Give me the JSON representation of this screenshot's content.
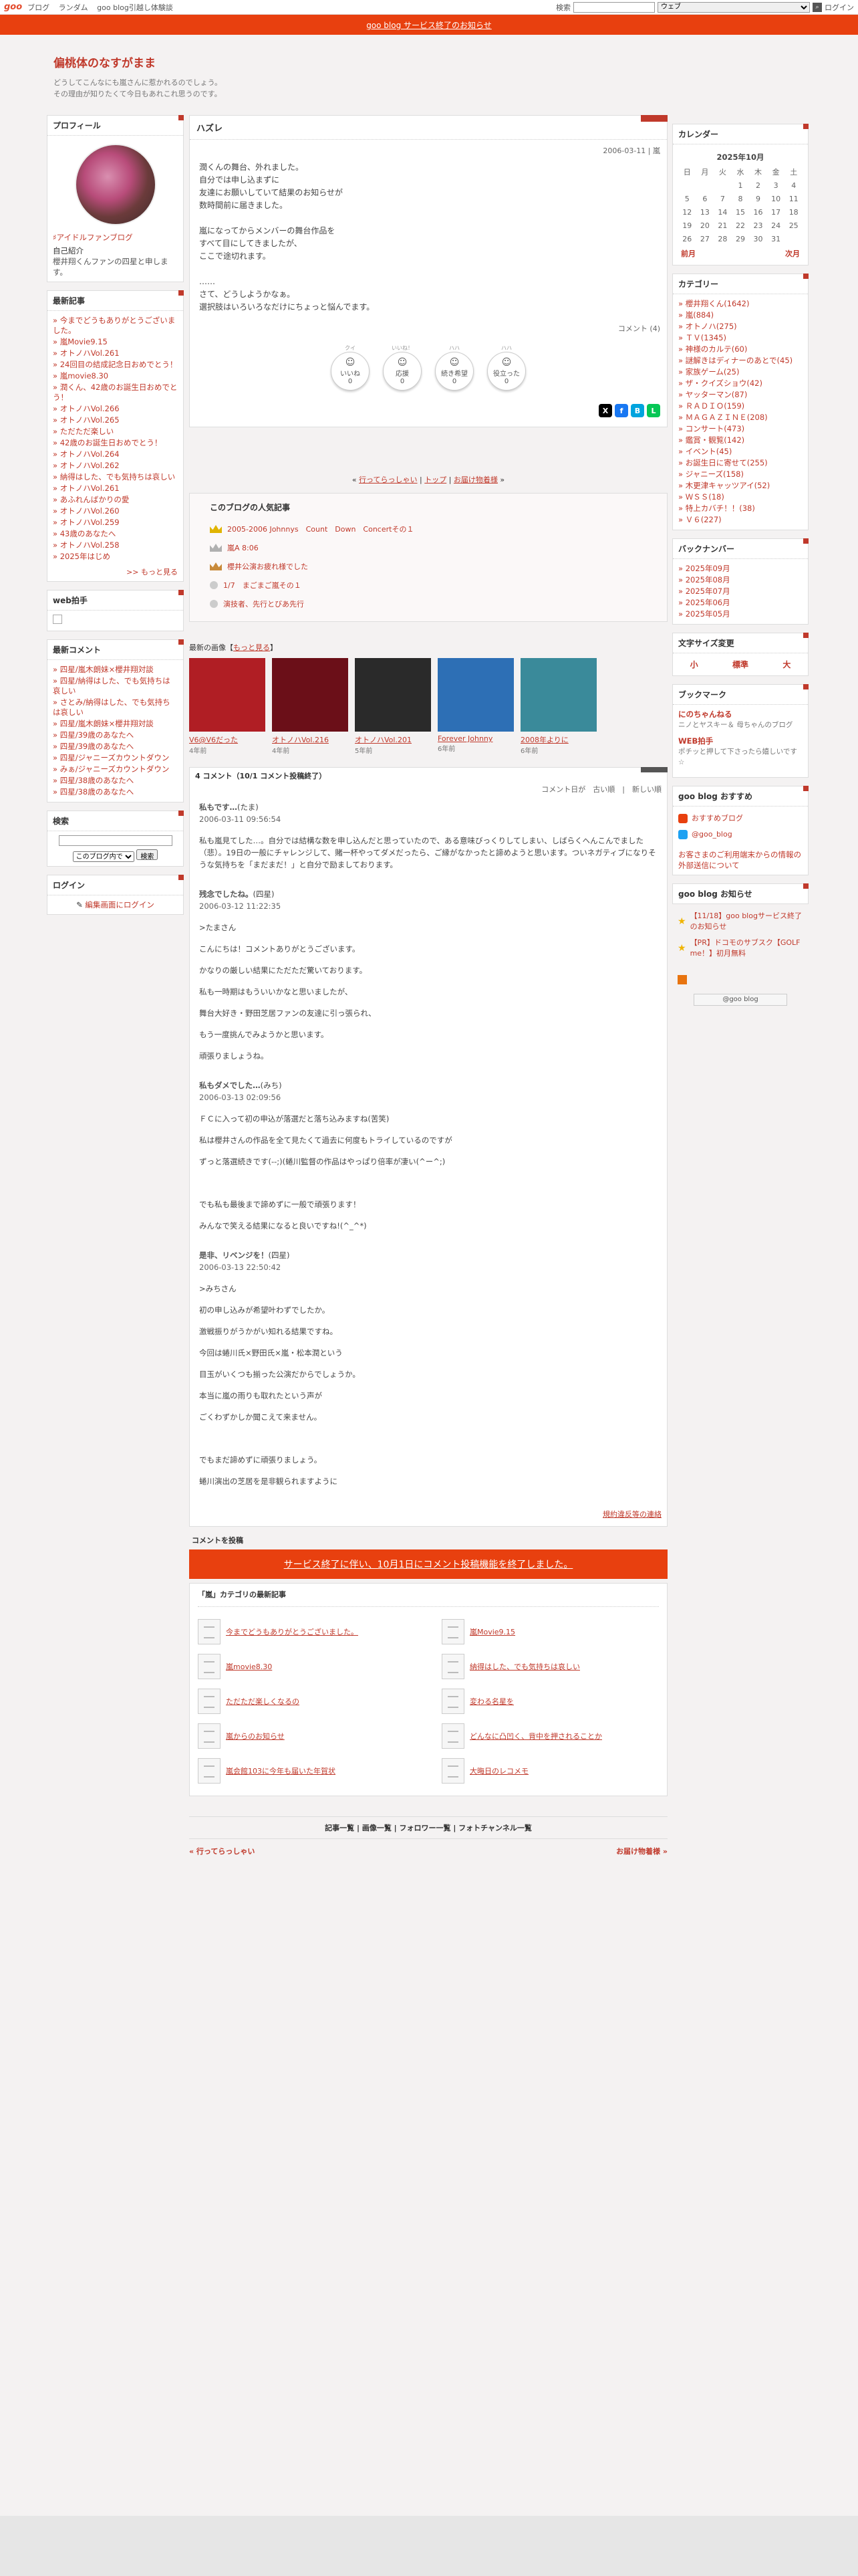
{
  "topbar": {
    "logo": "goo",
    "nav": [
      "ブログ",
      "ランダム",
      "goo blog引越し体験談"
    ],
    "search_label": "検索",
    "search_select": "ウェブ",
    "login": "ログイン"
  },
  "notice": "goo blog サービス終了のお知らせ",
  "header": {
    "title": "偏桃体のなすがまま",
    "desc1": "どうしてこんなにも嵐さんに惹かれるのでしょう。",
    "desc2": "その理由が知りたくて今日もあれこれ思うのです。"
  },
  "left": {
    "profile": {
      "heading": "プロフィール",
      "fan": "♯アイドルファンブログ",
      "intro_label": "自己紹介",
      "intro": "櫻井翔くんファンの四星と申します。"
    },
    "recent": {
      "heading": "最新記事",
      "items": [
        "今までどうもありがとうございました。",
        "嵐Movie9.15",
        "オトノハVol.261",
        "24回目の結成記念日おめでとう！",
        "嵐movie8.30",
        "潤くん、42歳のお誕生日おめでとう！",
        "オトノハVol.266",
        "オトノハVol.265",
        "ただただ楽しい",
        "42歳のお誕生日おめでとう！",
        "オトノハVol.264",
        "オトノハVol.262",
        "納得はした、でも気持ちは哀しい",
        "オトノハVol.261",
        "あふれんばかりの愛",
        "オトノハVol.260",
        "オトノハVol.259",
        "43歳のあなたへ",
        "オトノハVol.258",
        "2025年はじめ"
      ],
      "more": ">> もっと見る"
    },
    "webclap": {
      "heading": "web拍手"
    },
    "comments": {
      "heading": "最新コメント",
      "items": [
        "四星/嵐木朗妹×櫻井翔対談",
        "四星/納得はした、でも気持ちは哀しい",
        "さとみ/納得はした、でも気持ちは哀しい",
        "四星/嵐木朗妹×櫻井翔対談",
        "四星/39歳のあなたへ",
        "四星/39歳のあなたへ",
        "四星/ジャニーズカウントダウン",
        "みぁ/ジャニーズカウントダウン",
        "四星/38歳のあなたへ",
        "四星/38歳のあなたへ"
      ]
    },
    "search": {
      "heading": "検索",
      "select": "このブログ内で",
      "button": "検索"
    },
    "login": {
      "heading": "ログイン",
      "link": "編集画面にログイン"
    }
  },
  "article": {
    "title": "ハズレ",
    "date": "2006-03-11 | 嵐",
    "lines": [
      "潤くんの舞台、外れました。",
      "自分では申し込まずに",
      "友達にお願いしていて結果のお知らせが",
      "数時間前に届きました。",
      "",
      "嵐になってからメンバーの舞台作品を",
      "すべて目にしてきましたが、",
      "ここで途切れます。",
      "",
      "……",
      "さて、どうしようかなぁ。",
      "選択肢はいろいろなだけにちょっと悩んでます。"
    ],
    "comment_link": "コメント (4)",
    "reactions": [
      {
        "top": "クイ",
        "label": "いいね",
        "count": "0"
      },
      {
        "top": "いいね！",
        "label": "応援",
        "count": "0"
      },
      {
        "top": "ハハ",
        "label": "続き希望",
        "count": "0"
      },
      {
        "top": "ハハ",
        "label": "役立った",
        "count": "0"
      }
    ]
  },
  "pagenav": {
    "prev": "行ってらっしゃい",
    "top": "トップ",
    "next": "お届け物着様"
  },
  "popular": {
    "heading": "このブログの人気記事",
    "items": [
      "2005-2006 Johnnys　Count　Down　Concertその１",
      "嵐A 8:06",
      "櫻井公演お疲れ様でした",
      "1/7　まごまご嵐その１",
      "演技者、先行とびあ先行"
    ]
  },
  "recentimg": {
    "heading": "最新の画像",
    "more": "もっと見る",
    "items": [
      {
        "title": "V6@V6だった",
        "ago": "4年前",
        "c": "#b01e24"
      },
      {
        "title": "オトノハVol.216",
        "ago": "4年前",
        "c": "#6b0f18"
      },
      {
        "title": "オトノハVol.201",
        "ago": "5年前",
        "c": "#2a2a2a"
      },
      {
        "title": "Forever Johnny",
        "ago": "6年前",
        "c": "#2d6fb5"
      },
      {
        "title": "2008年よりに",
        "ago": "6年前",
        "c": "#3a8a9a"
      }
    ]
  },
  "comments": {
    "heading": "4 コメント（10/1 コメント投稿終了）",
    "order": "コメント日が　古い順　|　新しい順",
    "items": [
      {
        "name": "私もです…",
        "who": "(たま)",
        "date": "2006-03-11 09:56:54",
        "text": [
          "私も嵐見てした…。自分では結構な数を申し込んだと思っていたので、ある意味びっくりしてしまい、しばらくへんこんでました（悲）。19日の一般にチャレンジして、賭一杯やってダメだったら、ご縁がなかったと諦めようと思います。ついネガティブになりそうな気持ちを「まだまだ！」と自分で励ましております。"
        ]
      },
      {
        "name": "残念でしたね。",
        "who": "(四星)",
        "date": "2006-03-12 11:22:35",
        "text": [
          ">たまさん",
          "こんにちは！コメントありがとうございます。",
          "かなりの厳しい結果にただただ驚いております。",
          "私も一時期はもういいかなと思いましたが、",
          "舞台大好き・野田芝居ファンの友達に引っ張られ、",
          "もう一度挑んでみようかと思います。",
          "頑張りましょうね。"
        ]
      },
      {
        "name": "私もダメでした…",
        "who": "(みち)",
        "date": "2006-03-13 02:09:56",
        "text": [
          "ＦＣに入って初の申込が落選だと落ち込みますね(苦笑)",
          "私は櫻井さんの作品を全て見たくて過去に何度もトライしているのですが",
          "ずっと落選続きです(--;)(蜷川監督の作品はやっぱり倍率が凄い(^ー^;)",
          "",
          "でも私も最後まで諦めずに一般で頑張ります！",
          "みんなで笑える結果になると良いですね!(^_^*)"
        ]
      },
      {
        "name": "是非、リベンジを！",
        "who": "(四星)",
        "date": "2006-03-13 22:50:42",
        "text": [
          ">みちさん",
          "初の申し込みが希望叶わずでしたか。",
          "激戦振りがうかがい知れる結果ですね。",
          "今回は蜷川氏×野田氏×嵐・松本潤という",
          "目玉がいくつも揃った公演だからでしょうか。",
          "本当に嵐の雨りも取れたという声が",
          "ごくわずかしか聞こえて来ません。",
          "",
          "でもまだ諦めずに頑張りましょう。",
          "蜷川演出の芝居を是非観られますように"
        ]
      }
    ],
    "unsafe": "規約違反等の連絡"
  },
  "post": {
    "heading": "コメントを投稿",
    "button": "サービス終了に伴い、10月1日にコメント投稿機能を終了しました。"
  },
  "catrecent": {
    "heading": "「嵐」カテゴリの最新記事",
    "items": [
      "今までどうもありがとうございました。",
      "嵐Movie9.15",
      "嵐movie8.30",
      "納得はした、でも気持ちは哀しい",
      "ただただ楽しくなるの",
      "変わる名星を",
      "嵐からのお知らせ",
      "どんなに凸凹く、背中を押されることか",
      "嵐会館103に今年も届いた年賀状",
      "大晦日のレコメモ"
    ]
  },
  "footnav": "記事一覧 | 画像一覧 | フォロワー一覧 | フォトチャンネル一覧",
  "footlinks": {
    "prev": "« 行ってらっしゃい",
    "next": "お届け物着様 »"
  },
  "right": {
    "calendar": {
      "heading": "カレンダー",
      "month": "2025年10月",
      "days": [
        "日",
        "月",
        "火",
        "水",
        "木",
        "金",
        "土"
      ],
      "rows": [
        [
          "",
          "",
          "",
          "1",
          "2",
          "3",
          "4"
        ],
        [
          "5",
          "6",
          "7",
          "8",
          "9",
          "10",
          "11"
        ],
        [
          "12",
          "13",
          "14",
          "15",
          "16",
          "17",
          "18"
        ],
        [
          "19",
          "20",
          "21",
          "22",
          "23",
          "24",
          "25"
        ],
        [
          "26",
          "27",
          "28",
          "29",
          "30",
          "31",
          ""
        ]
      ],
      "prev": "前月",
      "next": "次月"
    },
    "category": {
      "heading": "カテゴリー",
      "items": [
        "櫻井翔くん(1642)",
        "嵐(884)",
        "オトノハ(275)",
        "ＴＶ(1345)",
        "神様のカルテ(60)",
        "謎解きはディナーのあとで(45)",
        "家族ゲーム(25)",
        "ザ・クイズショウ(42)",
        "ヤッターマン(87)",
        "ＲＡＤＩＯ(159)",
        "ＭＡＧＡＺＩＮＥ(208)",
        "コンサート(473)",
        "鑑賞・観覧(142)",
        "イベント(45)",
        "お誕生日に寄せて(255)",
        "ジャニーズ(158)",
        "木更津キャッツアイ(52)",
        "ＷＳＳ(18)",
        "特上カバチ！！(38)",
        "Ｖ６(227)"
      ]
    },
    "backnumber": {
      "heading": "バックナンバー",
      "items": [
        "2025年09月",
        "2025年08月",
        "2025年07月",
        "2025年06月",
        "2025年05月"
      ]
    },
    "fontsize": {
      "heading": "文字サイズ変更",
      "small": "小",
      "normal": "標準",
      "large": "大"
    },
    "bookmark": {
      "heading": "ブックマーク",
      "items": [
        {
          "t": "にのちゃんねる",
          "d": "ニノとヤスキー＆ 母ちゃんのブログ"
        },
        {
          "t": "WEB拍手",
          "d": "ポチッと押して下さったら嬉しいです☆"
        }
      ]
    },
    "goo": {
      "heading": "goo blog おすすめ",
      "items": [
        "おすすめブログ",
        "@goo_blog"
      ],
      "notice": "お客さまのご利用端末からの情報の外部送信について"
    },
    "goonews": {
      "heading": "goo blog お知らせ",
      "items": [
        "【11/18】goo blogサービス終了のお知らせ",
        "【PR】ドコモのサブスク【GOLF me！】初月無料"
      ],
      "btn": "@goo blog"
    }
  },
  "colors": {
    "accent": "#c0392b",
    "notice": "#e8400f"
  }
}
